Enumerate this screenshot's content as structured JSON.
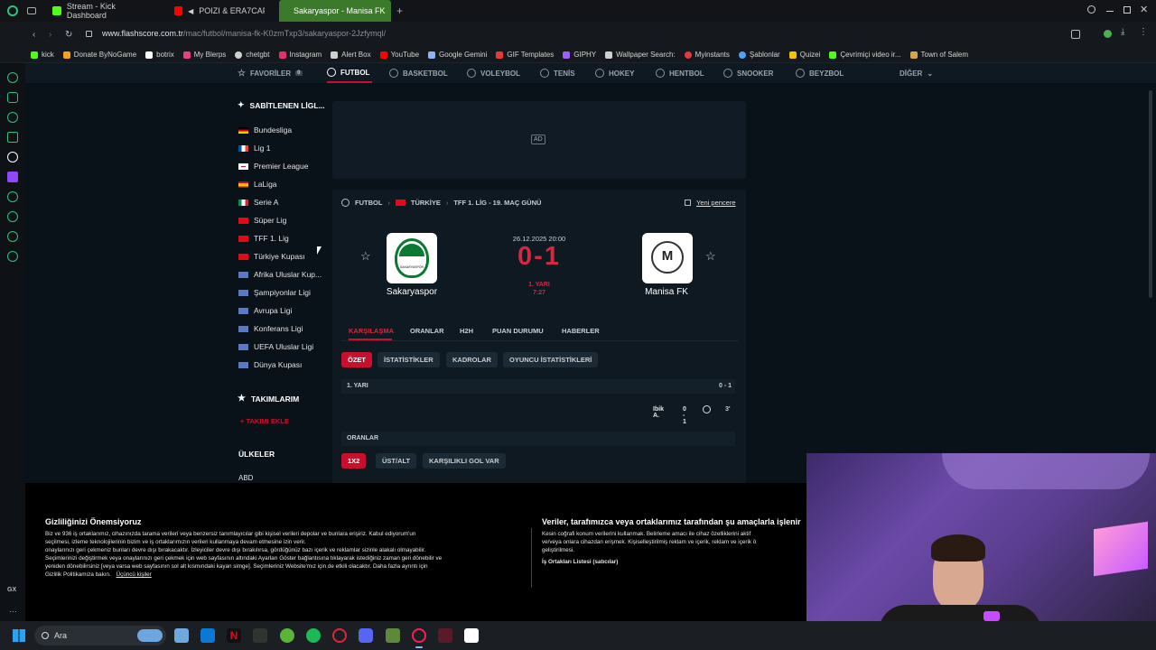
{
  "browser": {
    "tabs": [
      {
        "label": "Stream - Kick Dashboard",
        "color": "#53fc18"
      },
      {
        "label": "POIZI & ERA7CAPONE",
        "color": "#ff0000"
      },
      {
        "label": "Sakaryaspor - Manisa FK",
        "color": "#ffffff"
      }
    ],
    "url_main": "www.flashscore.com.tr",
    "url_path": "/mac/futbol/manisa-fk-K0zmTxp3/sakaryaspor-2Jzfymql/",
    "bookmarks": [
      {
        "label": "kick",
        "color": "#53fc18"
      },
      {
        "label": "Donate ByNoGame",
        "color": "#f4a11d"
      },
      {
        "label": "botrix",
        "color": "#ffffff"
      },
      {
        "label": "My Blerps",
        "color": "#e6417c"
      },
      {
        "label": "chetgbt",
        "color": "#d0d0d0"
      },
      {
        "label": "Instagram",
        "color": "#e1306c"
      },
      {
        "label": "Alert Box",
        "color": "#d0d0d0"
      },
      {
        "label": "YouTube",
        "color": "#ff0000"
      },
      {
        "label": "Google Gemini",
        "color": "#8ab4f8"
      },
      {
        "label": "GIF Templates",
        "color": "#e33b3b"
      },
      {
        "label": "GIPHY",
        "color": "#a05cff"
      },
      {
        "label": "Wallpaper Search:",
        "color": "#d0d0d0"
      },
      {
        "label": "Myinstants",
        "color": "#e33b3b"
      },
      {
        "label": "Şablonlar",
        "color": "#4fa3f7"
      },
      {
        "label": "Quizei",
        "color": "#f4c20d"
      },
      {
        "label": "Çevrimiçi video ir...",
        "color": "#53fc18"
      },
      {
        "label": "Town of Salem",
        "color": "#d8a44a"
      }
    ]
  },
  "sports_nav": [
    {
      "label": "FAVORİLER",
      "active": false
    },
    {
      "label": "FUTBOL",
      "active": true
    },
    {
      "label": "BASKETBOL",
      "active": false
    },
    {
      "label": "VOLEYBOL",
      "active": false
    },
    {
      "label": "TENİS",
      "active": false
    },
    {
      "label": "HOKEY",
      "active": false
    },
    {
      "label": "HENTBOL",
      "active": false
    },
    {
      "label": "SNOOKER",
      "active": false
    },
    {
      "label": "BEYZBOL",
      "active": false
    },
    {
      "label": "DİĞER",
      "active": false
    }
  ],
  "favorites_count": "0",
  "pinned": {
    "title": "SABİTLENEN LİGL...",
    "leagues": [
      {
        "label": "Bundesliga",
        "flag": "de"
      },
      {
        "label": "Lig 1",
        "flag": "fr"
      },
      {
        "label": "Premier League",
        "flag": "en"
      },
      {
        "label": "LaLiga",
        "flag": "es"
      },
      {
        "label": "Serie A",
        "flag": "it"
      },
      {
        "label": "Süper Lig",
        "flag": "tr"
      },
      {
        "label": "TFF 1. Lig",
        "flag": "tr"
      },
      {
        "label": "Türkiye Kupası",
        "flag": "tr"
      },
      {
        "label": "Afrika Uluslar Kup...",
        "flag": "world"
      },
      {
        "label": "Şampiyonlar Ligi",
        "flag": "world"
      },
      {
        "label": "Avrupa Ligi",
        "flag": "world"
      },
      {
        "label": "Konferans Ligi",
        "flag": "world"
      },
      {
        "label": "UEFA Uluslar Ligi",
        "flag": "world"
      },
      {
        "label": "Dünya Kupası",
        "flag": "world"
      }
    ]
  },
  "my_teams": {
    "title": "TAKIMLARIM",
    "add": "+ TAKIMI EKLE"
  },
  "countries": {
    "title": "ÜLKELER",
    "first": "ABD"
  },
  "ad_label": "AD",
  "breadcrumb": {
    "sport": "FUTBOL",
    "country": "TÜRKİYE",
    "league": "TFF 1. LİG - 19. MAÇ GÜNÜ",
    "new_window": "Yeni pencere"
  },
  "match": {
    "datetime": "26.12.2025 20:00",
    "score": "0-1",
    "status": "1. YARI",
    "minute": "7:27",
    "home": "Sakaryaspor",
    "away": "Manisa FK",
    "home_abbr": "SAKARYASPOR",
    "away_abbr": "M"
  },
  "match_tabs": [
    "KARŞILAŞMA",
    "ORANLAR",
    "H2H",
    "PUAN DURUMU",
    "HABERLER"
  ],
  "sub_tabs": [
    "ÖZET",
    "İSTATİSTİKLER",
    "KADROLAR",
    "OYUNCU İSTATİSTİKLERİ"
  ],
  "summary": {
    "period": "1. YARI",
    "period_score": "0 - 1",
    "scorer": "Ibik A.",
    "event_score": "0 - 1",
    "event_minute": "3'"
  },
  "odds": {
    "title": "ORANLAR",
    "tabs": [
      "1X2",
      "ÜST/ALT",
      "KARŞILIKLI GOL VAR"
    ]
  },
  "cookie": {
    "left_title": "Gizliliğinizi Önemsiyoruz",
    "left_text_1": "Biz ve 936 iş ortaklarımız, cihazınızda tarama verileri veya benzersiz tanımlayıcılar gibi kişisel verileri depolar ve bunlara erişiriz. Kabul ediyorum'un",
    "left_text_2": "seçilmesi, izleme teknolojilerinin bizim ve iş ortaklarımızın verileri kullanmaya devam etmesine izin verir.",
    "left_text_3": "onaylarınızı geri çekmeniz bunları devre dışı bırakacaktır. İzleyiciler devre dışı bırakılırsa, gördüğünüz bazı içerik ve reklamlar sizinle alakalı olmayabilir.",
    "left_text_4": "Seçimlerinizi değiştirmek veya onaylarınızı geri çekmek için web sayfasının altındaki Ayarları Göster bağlantısına tıklayarak istediğiniz zaman geri dönebilir ve",
    "left_text_5": "yeniden dönebilirsiniz [veya varsa web sayfasının sol alt kısmındaki kayan simge]. Seçimleriniz Website'mız için de etkili olacaktır. Daha fazla ayrıntı için",
    "left_text_6": "Gizlilik Politikamıza bakın.",
    "left_link": "Üçüncü kişiler",
    "right_title": "Veriler, tarafımızca veya ortaklarımız tarafından şu amaçlarla işlenir",
    "right_text_1": "Kesin coğrafi konum verilerini kullanmak. Belirleme amacı ile cihaz özelliklerini aktif",
    "right_text_2": "ve/veya onlara cihazdan erişmek. Kişiselleştirilmiş reklam ve içerik, reklam ve içerik ö",
    "right_text_3": "geliştirilmesi.",
    "right_link": "İş Ortakları Listesi (satıcılar)"
  },
  "taskbar": {
    "search": "Ara"
  }
}
